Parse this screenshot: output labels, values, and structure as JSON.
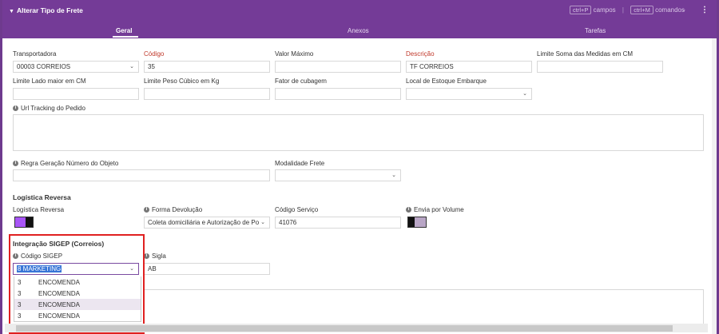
{
  "window": {
    "title": "Alterar Tipo de Frete",
    "shortcut1_key": "ctrl+P",
    "shortcut1_label": "campos",
    "shortcut_sep": "|",
    "shortcut2_key": "ctrl+M",
    "shortcut2_label": "comandos"
  },
  "tabs": [
    "Geral",
    "Anexos",
    "Tarefas"
  ],
  "form": {
    "transportadora": {
      "label": "Transportadora",
      "value": "00003 CORREIOS"
    },
    "codigo": {
      "label": "Código",
      "value": "35"
    },
    "valor_maximo": {
      "label": "Valor Máximo",
      "value": ""
    },
    "descricao": {
      "label": "Descrição",
      "value": "TF CORREIOS"
    },
    "limite_soma": {
      "label": "Limite Soma das Medidas em CM",
      "value": ""
    },
    "limite_lado": {
      "label": "Limite Lado maior em CM",
      "value": ""
    },
    "limite_peso": {
      "label": "Limite Peso Cúbico em Kg",
      "value": ""
    },
    "fator_cubagem": {
      "label": "Fator de cubagem",
      "value": ""
    },
    "local_estoque": {
      "label": "Local de Estoque Embarque",
      "value": ""
    },
    "url_tracking": {
      "label": "Url Tracking do Pedido",
      "value": ""
    },
    "regra_geracao": {
      "label": "Regra Geração Número do Objeto",
      "value": ""
    },
    "modalidade_frete": {
      "label": "Modalidade Frete",
      "value": ""
    }
  },
  "logistica": {
    "section_title": "Logística Reversa",
    "logistica_reversa_label": "Logística Reversa",
    "forma_devolucao": {
      "label": "Forma Devolução",
      "value": "Coleta domiciliária e Autorização de Post"
    },
    "codigo_servico": {
      "label": "Código Serviço",
      "value": "41076"
    },
    "envia_por_volume_label": "Envia por Volume",
    "toggle_on_color": "#a855f7",
    "toggle_off_color": "#b9a6c6"
  },
  "sigep": {
    "section_title": "Integração SIGEP (Correios)",
    "codigo_sigep": {
      "label": "Código SIGEP",
      "value": "8 MARKETING"
    },
    "sigla": {
      "label": "Sigla",
      "value": "AB"
    },
    "options": [
      {
        "code": "3",
        "name": "ENCOMENDA"
      },
      {
        "code": "3",
        "name": "ENCOMENDA"
      },
      {
        "code": "3",
        "name": "ENCOMENDA"
      },
      {
        "code": "3",
        "name": "ENCOMENDA"
      }
    ]
  },
  "icons": {
    "caret": "▼",
    "chevron": "⌄",
    "kebab": "⋮",
    "info": "i"
  }
}
